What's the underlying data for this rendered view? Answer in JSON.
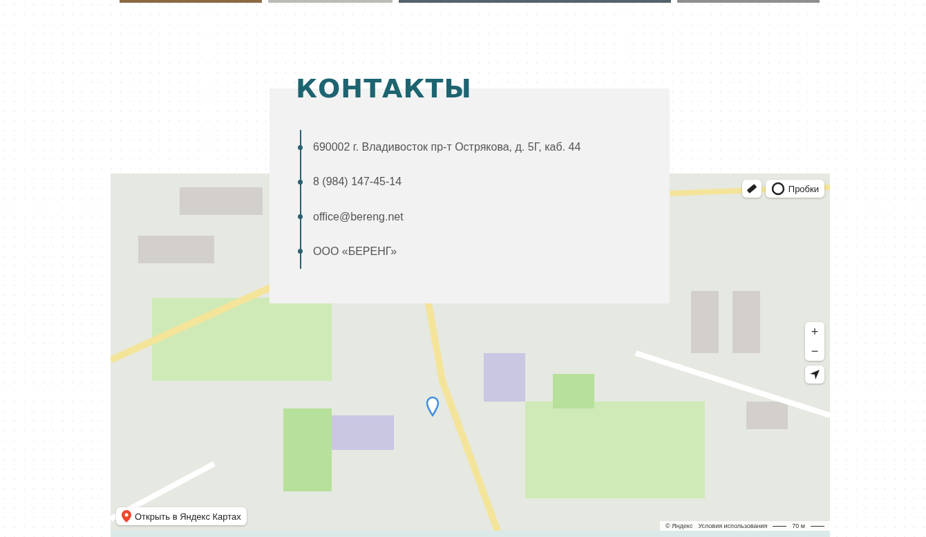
{
  "contacts": {
    "title": "КОНТАКТЫ",
    "items": [
      {
        "text": "690002 г. Владивосток пр-т Острякова, д. 5Г, каб. 44"
      },
      {
        "text": "8 (984) 147-45-14"
      },
      {
        "text": "office@bereng.net"
      },
      {
        "text": "ООО «БЕРЕНГ»"
      }
    ]
  },
  "map": {
    "traffic_label": "Пробки",
    "zoom_in": "+",
    "zoom_out": "−",
    "open_label": "Открыть в Яндекс Картах",
    "copyright": "© Яндекс",
    "terms": "Условия использования",
    "scale": "70 м"
  }
}
